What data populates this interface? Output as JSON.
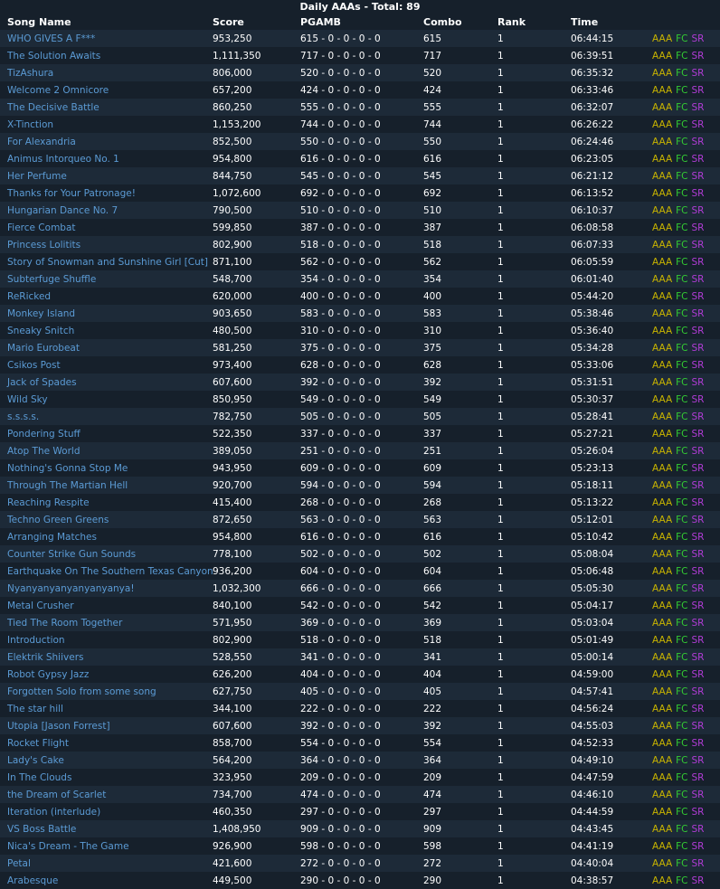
{
  "header": {
    "title": "Daily AAAs - Total: 89"
  },
  "columns": {
    "song": "Song Name",
    "score": "Score",
    "pgamb": "PGAMB",
    "combo": "Combo",
    "rank": "Rank",
    "time": "Time"
  },
  "flags": {
    "aaa": "AAA",
    "fc": "FC",
    "sr": "SR"
  },
  "colors": {
    "background": "#16202b",
    "row_alt": "#1d2a38",
    "link": "#5b9bd5",
    "aaa": "#c8b400",
    "fc": "#33cc33",
    "sr": "#b13cd6"
  },
  "rows": [
    {
      "song": "WHO GIVES A F***",
      "score": "953,250",
      "pgamb": "615 - 0 - 0 - 0 - 0",
      "combo": "615",
      "rank": "1",
      "time": "06:44:15"
    },
    {
      "song": "The Solution Awaits",
      "score": "1,111,350",
      "pgamb": "717 - 0 - 0 - 0 - 0",
      "combo": "717",
      "rank": "1",
      "time": "06:39:51"
    },
    {
      "song": "TizAshura",
      "score": "806,000",
      "pgamb": "520 - 0 - 0 - 0 - 0",
      "combo": "520",
      "rank": "1",
      "time": "06:35:32"
    },
    {
      "song": "Welcome 2 Omnicore",
      "score": "657,200",
      "pgamb": "424 - 0 - 0 - 0 - 0",
      "combo": "424",
      "rank": "1",
      "time": "06:33:46"
    },
    {
      "song": "The Decisive Battle",
      "score": "860,250",
      "pgamb": "555 - 0 - 0 - 0 - 0",
      "combo": "555",
      "rank": "1",
      "time": "06:32:07"
    },
    {
      "song": "X-Tinction",
      "score": "1,153,200",
      "pgamb": "744 - 0 - 0 - 0 - 0",
      "combo": "744",
      "rank": "1",
      "time": "06:26:22"
    },
    {
      "song": "For Alexandria",
      "score": "852,500",
      "pgamb": "550 - 0 - 0 - 0 - 0",
      "combo": "550",
      "rank": "1",
      "time": "06:24:46"
    },
    {
      "song": "Animus Intorqueo No. 1",
      "score": "954,800",
      "pgamb": "616 - 0 - 0 - 0 - 0",
      "combo": "616",
      "rank": "1",
      "time": "06:23:05"
    },
    {
      "song": "Her Perfume",
      "score": "844,750",
      "pgamb": "545 - 0 - 0 - 0 - 0",
      "combo": "545",
      "rank": "1",
      "time": "06:21:12"
    },
    {
      "song": "Thanks for Your Patronage!",
      "score": "1,072,600",
      "pgamb": "692 - 0 - 0 - 0 - 0",
      "combo": "692",
      "rank": "1",
      "time": "06:13:52"
    },
    {
      "song": "Hungarian Dance No. 7",
      "score": "790,500",
      "pgamb": "510 - 0 - 0 - 0 - 0",
      "combo": "510",
      "rank": "1",
      "time": "06:10:37"
    },
    {
      "song": "Fierce Combat",
      "score": "599,850",
      "pgamb": "387 - 0 - 0 - 0 - 0",
      "combo": "387",
      "rank": "1",
      "time": "06:08:58"
    },
    {
      "song": "Princess Lolitits",
      "score": "802,900",
      "pgamb": "518 - 0 - 0 - 0 - 0",
      "combo": "518",
      "rank": "1",
      "time": "06:07:33"
    },
    {
      "song": "Story of Snowman and Sunshine Girl [Cut]",
      "score": "871,100",
      "pgamb": "562 - 0 - 0 - 0 - 0",
      "combo": "562",
      "rank": "1",
      "time": "06:05:59"
    },
    {
      "song": "Subterfuge Shuffle",
      "score": "548,700",
      "pgamb": "354 - 0 - 0 - 0 - 0",
      "combo": "354",
      "rank": "1",
      "time": "06:01:40"
    },
    {
      "song": "ReRicked",
      "score": "620,000",
      "pgamb": "400 - 0 - 0 - 0 - 0",
      "combo": "400",
      "rank": "1",
      "time": "05:44:20"
    },
    {
      "song": "Monkey Island",
      "score": "903,650",
      "pgamb": "583 - 0 - 0 - 0 - 0",
      "combo": "583",
      "rank": "1",
      "time": "05:38:46"
    },
    {
      "song": "Sneaky Snitch",
      "score": "480,500",
      "pgamb": "310 - 0 - 0 - 0 - 0",
      "combo": "310",
      "rank": "1",
      "time": "05:36:40"
    },
    {
      "song": "Mario Eurobeat",
      "score": "581,250",
      "pgamb": "375 - 0 - 0 - 0 - 0",
      "combo": "375",
      "rank": "1",
      "time": "05:34:28"
    },
    {
      "song": "Csikos Post",
      "score": "973,400",
      "pgamb": "628 - 0 - 0 - 0 - 0",
      "combo": "628",
      "rank": "1",
      "time": "05:33:06"
    },
    {
      "song": "Jack of Spades",
      "score": "607,600",
      "pgamb": "392 - 0 - 0 - 0 - 0",
      "combo": "392",
      "rank": "1",
      "time": "05:31:51"
    },
    {
      "song": "Wild Sky",
      "score": "850,950",
      "pgamb": "549 - 0 - 0 - 0 - 0",
      "combo": "549",
      "rank": "1",
      "time": "05:30:37"
    },
    {
      "song": "s.s.s.s.",
      "score": "782,750",
      "pgamb": "505 - 0 - 0 - 0 - 0",
      "combo": "505",
      "rank": "1",
      "time": "05:28:41"
    },
    {
      "song": "Pondering Stuff",
      "score": "522,350",
      "pgamb": "337 - 0 - 0 - 0 - 0",
      "combo": "337",
      "rank": "1",
      "time": "05:27:21"
    },
    {
      "song": "Atop The World",
      "score": "389,050",
      "pgamb": "251 - 0 - 0 - 0 - 0",
      "combo": "251",
      "rank": "1",
      "time": "05:26:04"
    },
    {
      "song": "Nothing's Gonna Stop Me",
      "score": "943,950",
      "pgamb": "609 - 0 - 0 - 0 - 0",
      "combo": "609",
      "rank": "1",
      "time": "05:23:13"
    },
    {
      "song": "Through The Martian Hell",
      "score": "920,700",
      "pgamb": "594 - 0 - 0 - 0 - 0",
      "combo": "594",
      "rank": "1",
      "time": "05:18:11"
    },
    {
      "song": "Reaching Respite",
      "score": "415,400",
      "pgamb": "268 - 0 - 0 - 0 - 0",
      "combo": "268",
      "rank": "1",
      "time": "05:13:22"
    },
    {
      "song": "Techno Green Greens",
      "score": "872,650",
      "pgamb": "563 - 0 - 0 - 0 - 0",
      "combo": "563",
      "rank": "1",
      "time": "05:12:01"
    },
    {
      "song": "Arranging Matches",
      "score": "954,800",
      "pgamb": "616 - 0 - 0 - 0 - 0",
      "combo": "616",
      "rank": "1",
      "time": "05:10:42"
    },
    {
      "song": "Counter Strike Gun Sounds",
      "score": "778,100",
      "pgamb": "502 - 0 - 0 - 0 - 0",
      "combo": "502",
      "rank": "1",
      "time": "05:08:04"
    },
    {
      "song": "Earthquake On The Southern Texas Canyon",
      "score": "936,200",
      "pgamb": "604 - 0 - 0 - 0 - 0",
      "combo": "604",
      "rank": "1",
      "time": "05:06:48"
    },
    {
      "song": "Nyanyanyanyanyanyanya!",
      "score": "1,032,300",
      "pgamb": "666 - 0 - 0 - 0 - 0",
      "combo": "666",
      "rank": "1",
      "time": "05:05:30"
    },
    {
      "song": "Metal Crusher",
      "score": "840,100",
      "pgamb": "542 - 0 - 0 - 0 - 0",
      "combo": "542",
      "rank": "1",
      "time": "05:04:17"
    },
    {
      "song": "Tied The Room Together",
      "score": "571,950",
      "pgamb": "369 - 0 - 0 - 0 - 0",
      "combo": "369",
      "rank": "1",
      "time": "05:03:04"
    },
    {
      "song": "Introduction",
      "score": "802,900",
      "pgamb": "518 - 0 - 0 - 0 - 0",
      "combo": "518",
      "rank": "1",
      "time": "05:01:49"
    },
    {
      "song": "Elektrik Shiivers",
      "score": "528,550",
      "pgamb": "341 - 0 - 0 - 0 - 0",
      "combo": "341",
      "rank": "1",
      "time": "05:00:14"
    },
    {
      "song": "Robot Gypsy Jazz",
      "score": "626,200",
      "pgamb": "404 - 0 - 0 - 0 - 0",
      "combo": "404",
      "rank": "1",
      "time": "04:59:00"
    },
    {
      "song": "Forgotten Solo from some song",
      "score": "627,750",
      "pgamb": "405 - 0 - 0 - 0 - 0",
      "combo": "405",
      "rank": "1",
      "time": "04:57:41"
    },
    {
      "song": "The star hill",
      "score": "344,100",
      "pgamb": "222 - 0 - 0 - 0 - 0",
      "combo": "222",
      "rank": "1",
      "time": "04:56:24"
    },
    {
      "song": "Utopia [Jason Forrest]",
      "score": "607,600",
      "pgamb": "392 - 0 - 0 - 0 - 0",
      "combo": "392",
      "rank": "1",
      "time": "04:55:03"
    },
    {
      "song": "Rocket Flight",
      "score": "858,700",
      "pgamb": "554 - 0 - 0 - 0 - 0",
      "combo": "554",
      "rank": "1",
      "time": "04:52:33"
    },
    {
      "song": "Lady's Cake",
      "score": "564,200",
      "pgamb": "364 - 0 - 0 - 0 - 0",
      "combo": "364",
      "rank": "1",
      "time": "04:49:10"
    },
    {
      "song": "In The Clouds",
      "score": "323,950",
      "pgamb": "209 - 0 - 0 - 0 - 0",
      "combo": "209",
      "rank": "1",
      "time": "04:47:59"
    },
    {
      "song": "the Dream of Scarlet",
      "score": "734,700",
      "pgamb": "474 - 0 - 0 - 0 - 0",
      "combo": "474",
      "rank": "1",
      "time": "04:46:10"
    },
    {
      "song": "Iteration (interlude)",
      "score": "460,350",
      "pgamb": "297 - 0 - 0 - 0 - 0",
      "combo": "297",
      "rank": "1",
      "time": "04:44:59"
    },
    {
      "song": "VS Boss Battle",
      "score": "1,408,950",
      "pgamb": "909 - 0 - 0 - 0 - 0",
      "combo": "909",
      "rank": "1",
      "time": "04:43:45"
    },
    {
      "song": "Nica's Dream - The Game",
      "score": "926,900",
      "pgamb": "598 - 0 - 0 - 0 - 0",
      "combo": "598",
      "rank": "1",
      "time": "04:41:19"
    },
    {
      "song": "Petal",
      "score": "421,600",
      "pgamb": "272 - 0 - 0 - 0 - 0",
      "combo": "272",
      "rank": "1",
      "time": "04:40:04"
    },
    {
      "song": "Arabesque",
      "score": "449,500",
      "pgamb": "290 - 0 - 0 - 0 - 0",
      "combo": "290",
      "rank": "1",
      "time": "04:38:57"
    }
  ]
}
